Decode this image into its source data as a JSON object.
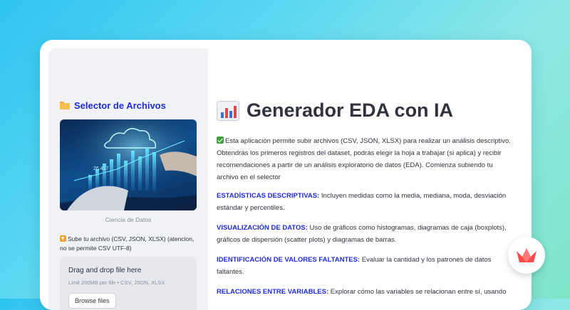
{
  "sidebar": {
    "title": "Selector de Archivos",
    "image_caption": "Ciencia de Datos",
    "image_overlay_number": "26.417",
    "upload_label": "Sube tu archivo (CSV, JSON, XLSX) (atencion, no se permite CSV UTF-8)",
    "dropzone": {
      "title": "Drag and drop file here",
      "subtitle": "Limit 200MB per file • CSV, JSON, XLSX",
      "browse_label": "Browse files"
    }
  },
  "main": {
    "title": "Generador EDA con IA",
    "intro": "Esta aplicación permite subir archivos (CSV, JSON, XLSX) para realizar un análisis descriptivo. Obtendrás los primeros registros del dataset, podrás elegir la hoja a trabajar (si aplica) y recibir recomendaciones a partir de un análisis exploratorio de datos (EDA). Comienza subiendo tu archivo en el selector",
    "sections": [
      {
        "heading": "ESTADÍSTICAS DESCRIPTIVAS:",
        "text": " Incluyen medidas como la media, mediana, moda, desviación estándar y percentiles."
      },
      {
        "heading": "VISUALIZACIÓN DE DATOS:",
        "text": " Uso de gráficos como histogramas, diagramas de caja (boxplots), gráficos de dispersión (scatter plots) y diagramas de barras."
      },
      {
        "heading": "IDENTIFICACIÓN DE VALORES FALTANTES:",
        "text": " Evaluar la cantidad y los patrones de datos faltantes."
      },
      {
        "heading": "RELACIONES ENTRE VARIABLES:",
        "text": " Explorar cómo las variables se relacionan entre sí, usando"
      }
    ]
  },
  "icons": {
    "sidebar_title": "folder-icon",
    "upload": "download-arrow-icon",
    "title": "bar-chart-icon",
    "intro": "check-icon",
    "badge": "crown-icon"
  },
  "colors": {
    "accent": "#1f2bd6",
    "sidebar_bg": "#f0f2f6",
    "text": "#31333f",
    "logo": "#ff4b4b"
  }
}
